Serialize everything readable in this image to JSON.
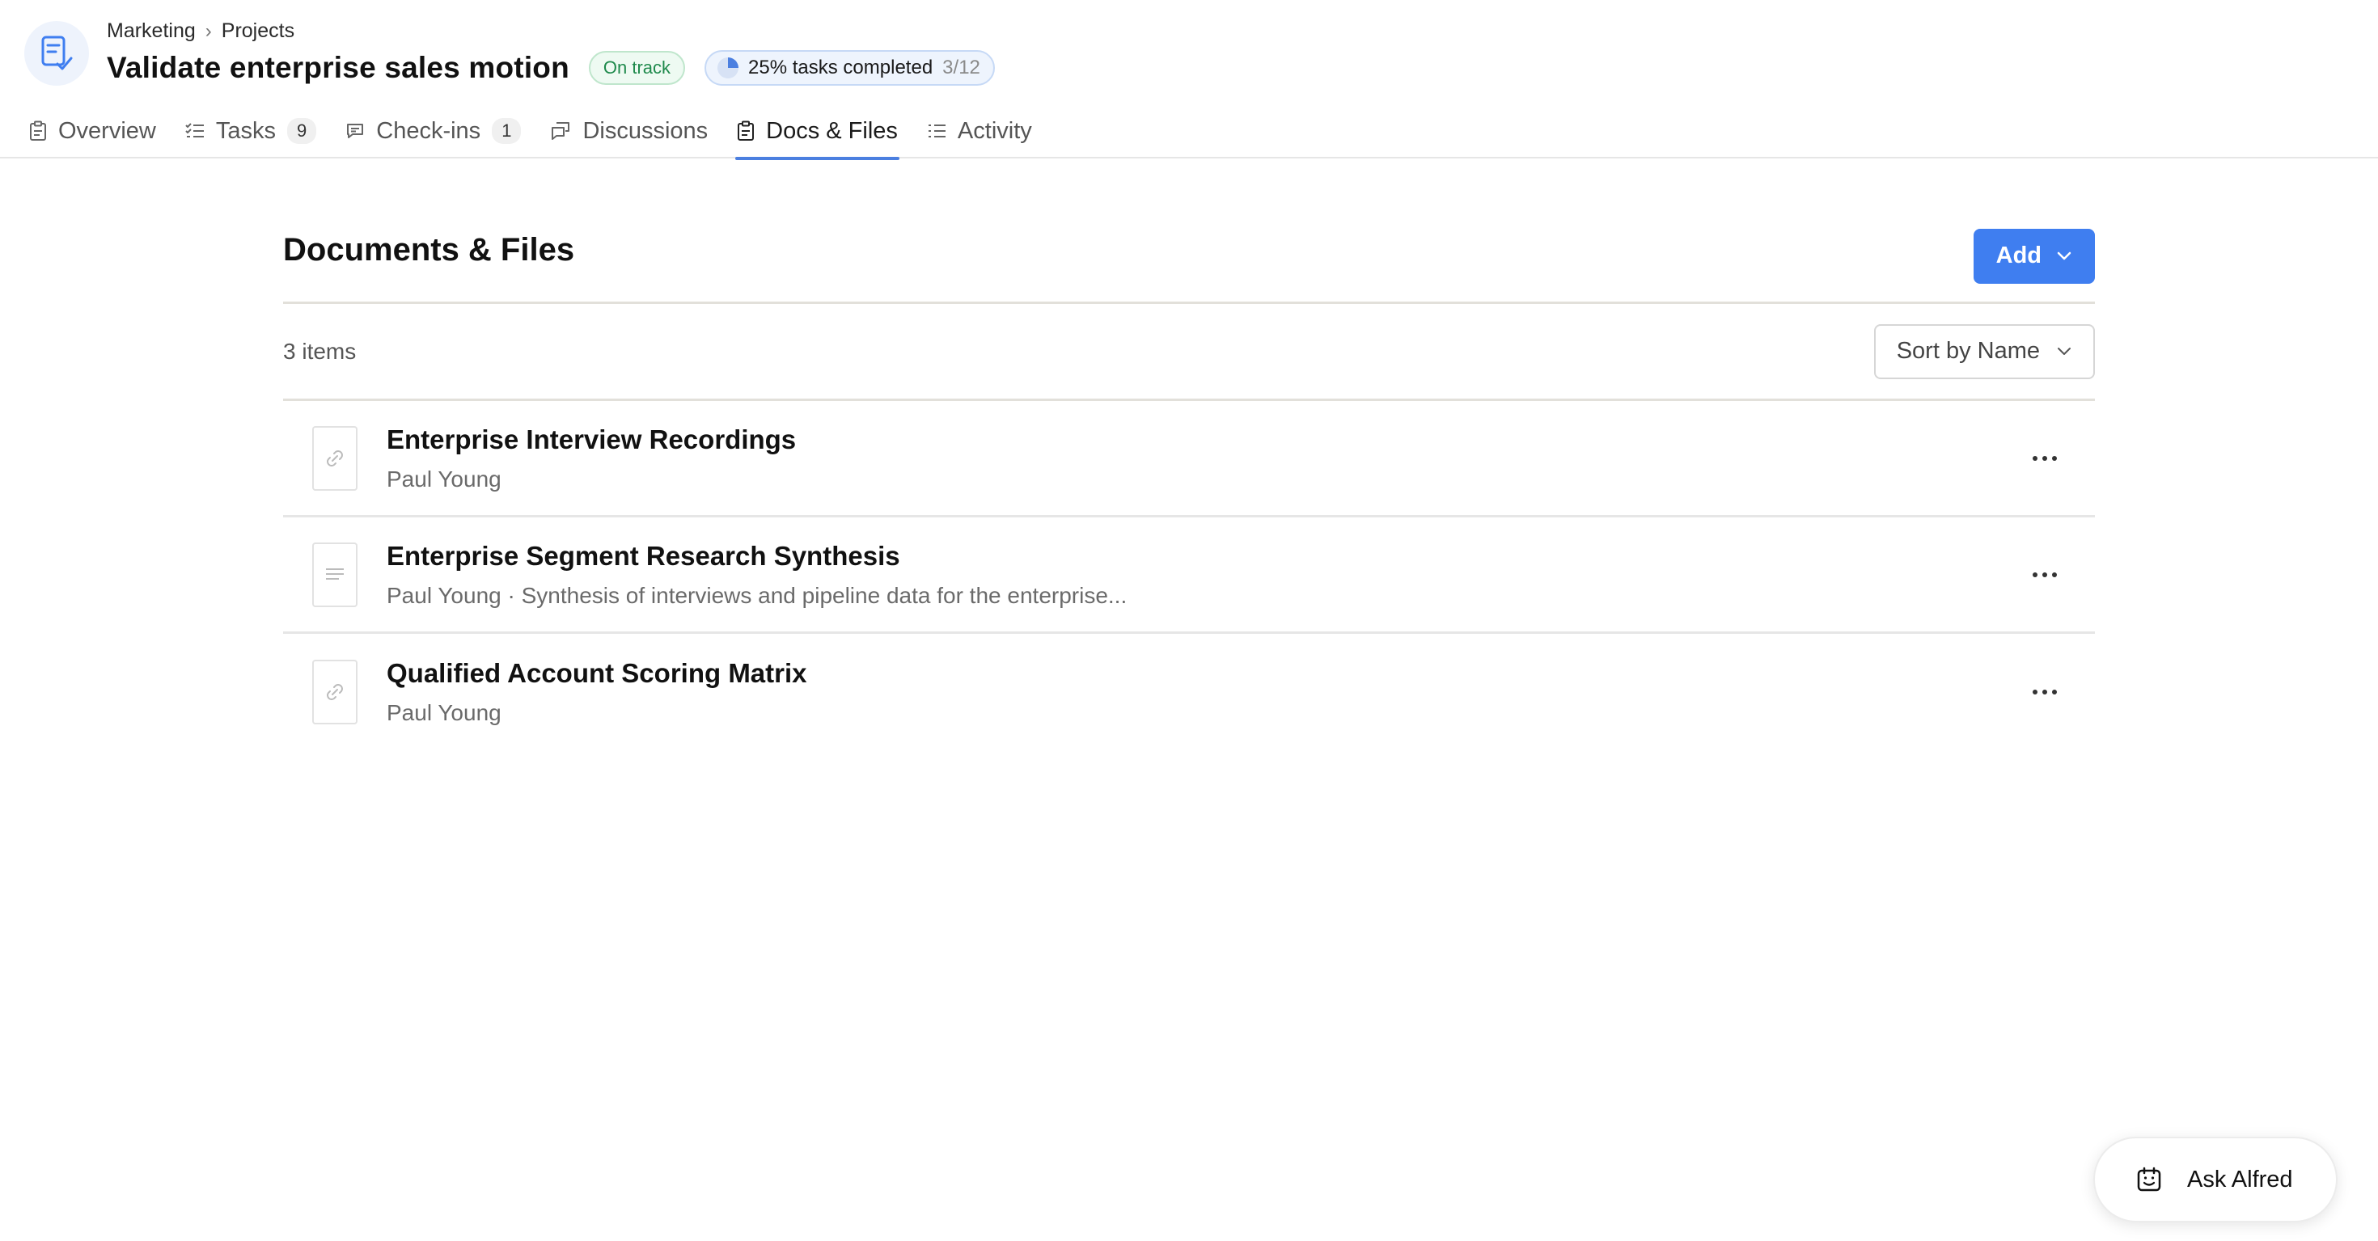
{
  "breadcrumb": {
    "parent": "Marketing",
    "separator": "›",
    "current": "Projects"
  },
  "project": {
    "title": "Validate enterprise sales motion",
    "status": "On track",
    "progress_label": "25% tasks completed",
    "progress_count": "3/12",
    "progress_fraction": 0.25
  },
  "tabs": [
    {
      "label": "Overview",
      "icon": "clipboard-icon"
    },
    {
      "label": "Tasks",
      "count": "9",
      "icon": "checklist-icon"
    },
    {
      "label": "Check-ins",
      "count": "1",
      "icon": "comment-icon"
    },
    {
      "label": "Discussions",
      "icon": "discussion-icon"
    },
    {
      "label": "Docs & Files",
      "icon": "clipboard-icon",
      "active": true
    },
    {
      "label": "Activity",
      "icon": "list-icon"
    }
  ],
  "section": {
    "title": "Documents & Files",
    "add_label": "Add",
    "items_count": "3 items",
    "sort_label": "Sort by Name"
  },
  "files": [
    {
      "title": "Enterprise Interview Recordings",
      "meta": "Paul Young",
      "icon": "link-icon"
    },
    {
      "title": "Enterprise Segment Research Synthesis",
      "meta": "Paul Young · Synthesis of interviews and pipeline data for the enterprise...",
      "icon": "document-icon"
    },
    {
      "title": "Qualified Account Scoring Matrix",
      "meta": "Paul Young",
      "icon": "link-icon"
    }
  ],
  "assistant": {
    "label": "Ask Alfred",
    "icon": "calendar-check-icon"
  },
  "colors": {
    "accent": "#3f7ef0",
    "status_green": "#1f8a4c",
    "tab_underline": "#4b7fe0"
  }
}
